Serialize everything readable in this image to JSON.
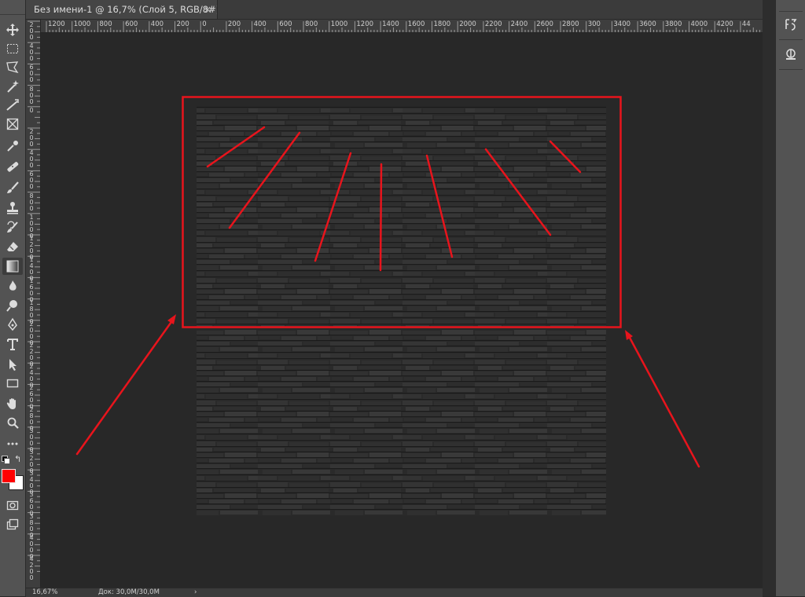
{
  "document": {
    "tab_title": "Без имени-1 @ 16,7% (Слой 5, RGB/8#) *",
    "close_glyph": "×"
  },
  "rulers": {
    "horizontal_labels": [
      "1200",
      "1000",
      "800",
      "600",
      "400",
      "200",
      "0",
      "200",
      "400",
      "600",
      "800",
      "1000",
      "1200",
      "1400",
      "1600",
      "1800",
      "2000",
      "2200",
      "2400",
      "2600",
      "2800",
      "300",
      "3400",
      "3600",
      "3800",
      "4000",
      "4200",
      "44"
    ],
    "vertical_labels": [
      "2 0 0",
      "4 0 0",
      "6 0 0",
      "8 0 0",
      "0",
      "2 0 0",
      "4 0 0",
      "6 0 0",
      "8 0 0",
      "1 0 0 0",
      "1 2 0 0",
      "1 4 0 0",
      "1 6 0 0",
      "1 8 0 0",
      "2 0 0 0",
      "2 2 0 0",
      "2 4 0 0",
      "2 6 0 0",
      "2 8 0 0",
      "3 0 0 0",
      "3 2 0 0",
      "3 4 0 0",
      "3 6 0 0",
      "3 8 0 0",
      "4 0 0 0",
      "4 2 0 0"
    ]
  },
  "status": {
    "zoom": "16,67%",
    "doc_size": "Док: 30,0M/30,0M",
    "arrow": "›"
  },
  "tools": [
    {
      "name": "move-tool",
      "icon": "move-icon"
    },
    {
      "name": "marquee-tool",
      "icon": "rect-marquee-icon"
    },
    {
      "name": "lasso-tool",
      "icon": "polygon-lasso-icon"
    },
    {
      "name": "quick-select-tool",
      "icon": "magic-wand-icon"
    },
    {
      "name": "crop-tool",
      "icon": "crop-icon"
    },
    {
      "name": "frame-tool",
      "icon": "frame-icon"
    },
    {
      "name": "eyedropper-tool",
      "icon": "eyedropper-icon"
    },
    {
      "name": "healing-tool",
      "icon": "bandage-icon"
    },
    {
      "name": "brush-tool",
      "icon": "brush-icon"
    },
    {
      "name": "stamp-tool",
      "icon": "stamp-icon"
    },
    {
      "name": "history-brush-tool",
      "icon": "history-brush-icon"
    },
    {
      "name": "eraser-tool",
      "icon": "eraser-icon"
    },
    {
      "name": "gradient-tool",
      "icon": "gradient-icon"
    },
    {
      "name": "blur-tool",
      "icon": "drop-icon"
    },
    {
      "name": "dodge-tool",
      "icon": "dodge-icon"
    },
    {
      "name": "pen-tool",
      "icon": "pen-icon"
    },
    {
      "name": "type-tool",
      "icon": "type-icon"
    },
    {
      "name": "path-select-tool",
      "icon": "arrow-select-icon"
    },
    {
      "name": "shape-tool",
      "icon": "rectangle-icon"
    },
    {
      "name": "hand-tool",
      "icon": "hand-icon"
    },
    {
      "name": "zoom-tool",
      "icon": "zoom-icon"
    },
    {
      "name": "more-tools",
      "icon": "ellipsis-icon"
    }
  ],
  "colors": {
    "foreground": "#ff0000",
    "background": "#ffffff",
    "annotation": "#e8141c",
    "ui_panel": "#535353",
    "workspace": "#282828"
  }
}
